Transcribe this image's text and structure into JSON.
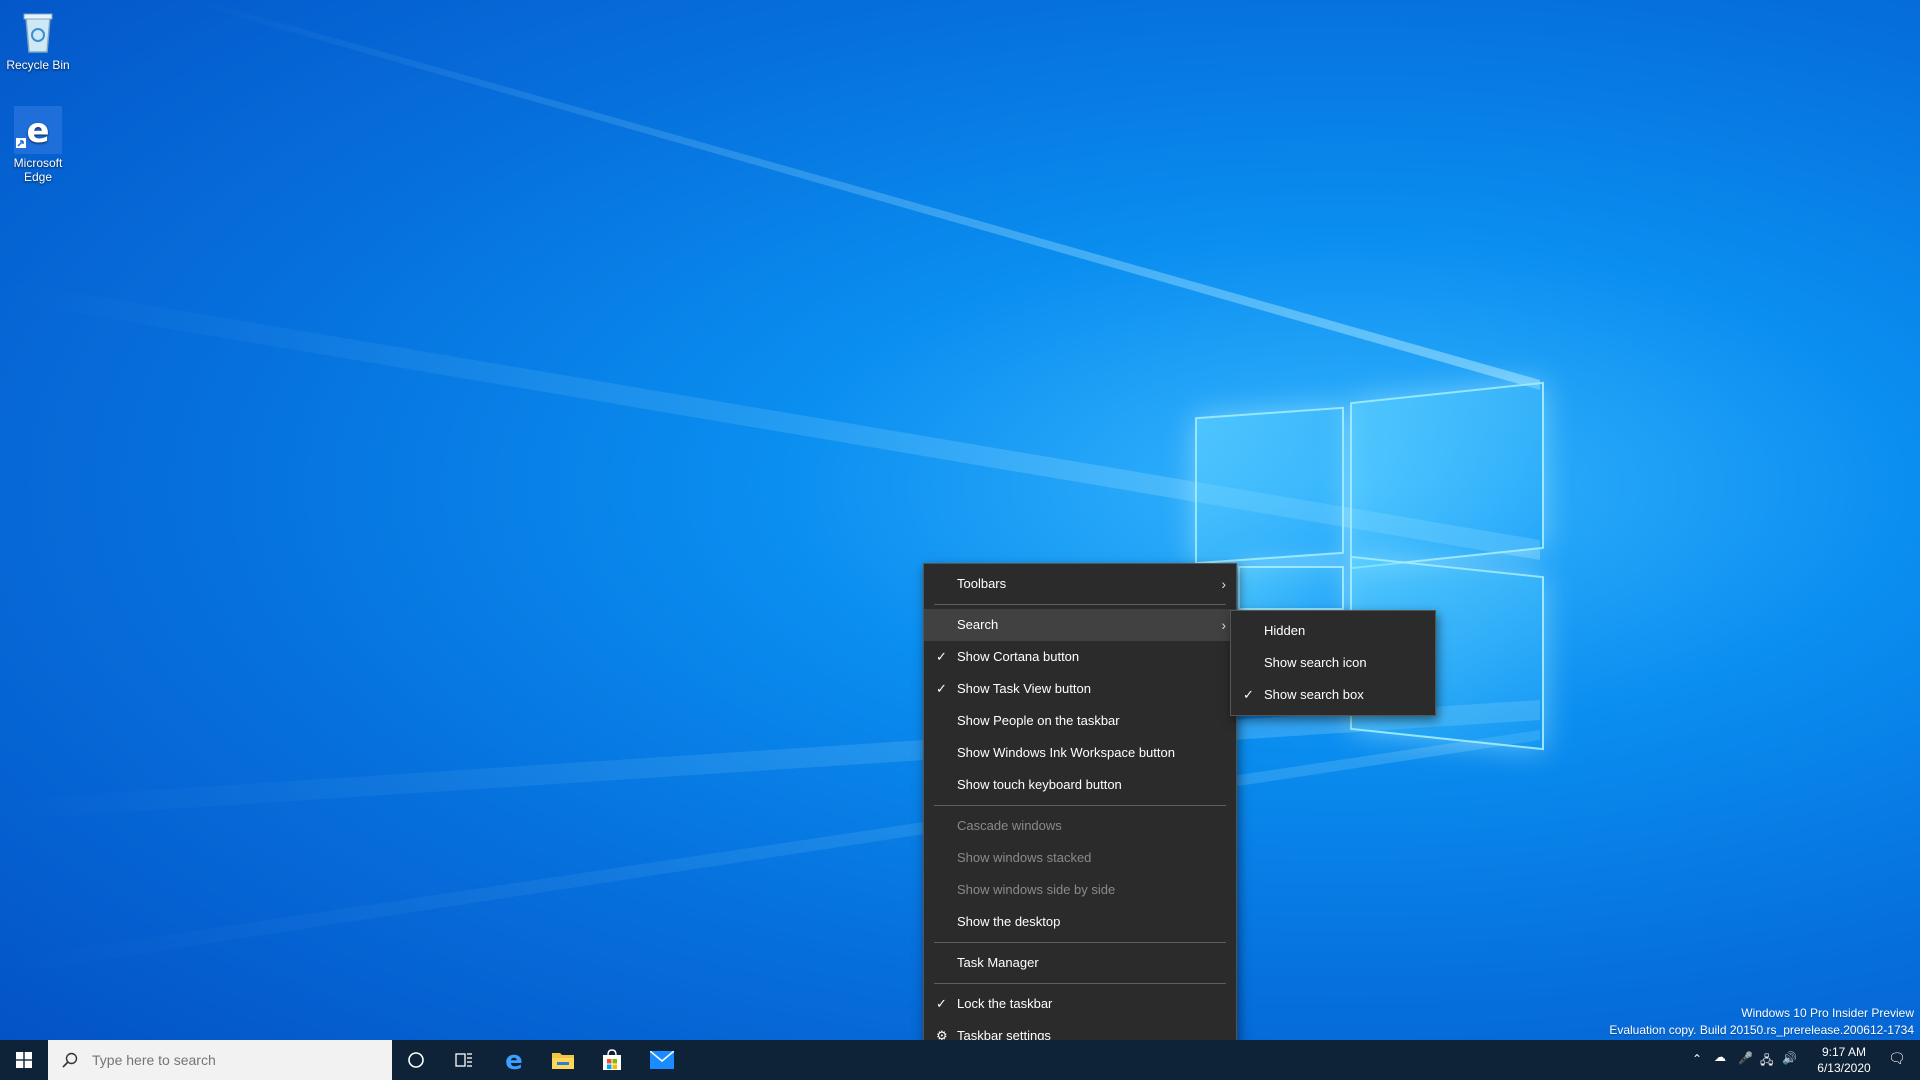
{
  "desktop": {
    "icons": [
      {
        "label": "Recycle Bin"
      },
      {
        "label": "Microsoft Edge"
      }
    ],
    "watermark": {
      "line1": "Windows 10 Pro Insider Preview",
      "line2": "Evaluation copy. Build 20150.rs_prerelease.200612-1734"
    }
  },
  "context_menu": {
    "toolbars": "Toolbars",
    "search": "Search",
    "show_cortana": "Show Cortana button",
    "show_task_view": "Show Task View button",
    "show_people": "Show People on the taskbar",
    "show_ink": "Show Windows Ink Workspace button",
    "show_touch_keyboard": "Show touch keyboard button",
    "cascade": "Cascade windows",
    "stacked": "Show windows stacked",
    "side_by_side": "Show windows side by side",
    "show_desktop": "Show the desktop",
    "task_manager": "Task Manager",
    "lock_taskbar": "Lock the taskbar",
    "taskbar_settings": "Taskbar settings"
  },
  "search_submenu": {
    "hidden": "Hidden",
    "show_icon": "Show search icon",
    "show_box": "Show search box"
  },
  "taskbar": {
    "search_placeholder": "Type here to search",
    "clock_time": "9:17 AM",
    "clock_date": "6/13/2020"
  },
  "colors": {
    "menu_bg": "#2b2b2b",
    "menu_hover": "#414141",
    "taskbar_bg": "#0e2238",
    "desktop_accent": "#0a8ef0"
  }
}
